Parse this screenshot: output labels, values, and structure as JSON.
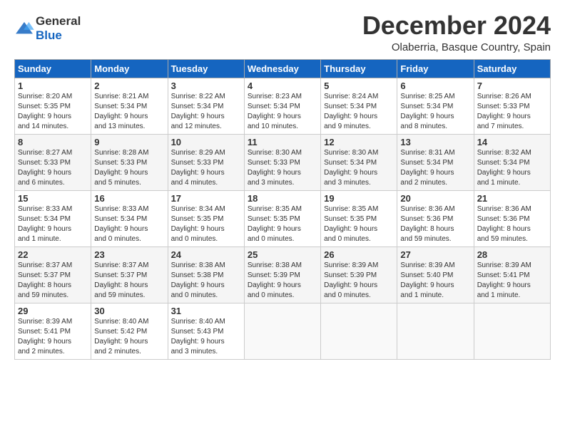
{
  "header": {
    "logo_line1": "General",
    "logo_line2": "Blue",
    "month_title": "December 2024",
    "location": "Olaberria, Basque Country, Spain"
  },
  "days_of_week": [
    "Sunday",
    "Monday",
    "Tuesday",
    "Wednesday",
    "Thursday",
    "Friday",
    "Saturday"
  ],
  "weeks": [
    [
      {
        "day": "1",
        "info": "Sunrise: 8:20 AM\nSunset: 5:35 PM\nDaylight: 9 hours\nand 14 minutes."
      },
      {
        "day": "2",
        "info": "Sunrise: 8:21 AM\nSunset: 5:34 PM\nDaylight: 9 hours\nand 13 minutes."
      },
      {
        "day": "3",
        "info": "Sunrise: 8:22 AM\nSunset: 5:34 PM\nDaylight: 9 hours\nand 12 minutes."
      },
      {
        "day": "4",
        "info": "Sunrise: 8:23 AM\nSunset: 5:34 PM\nDaylight: 9 hours\nand 10 minutes."
      },
      {
        "day": "5",
        "info": "Sunrise: 8:24 AM\nSunset: 5:34 PM\nDaylight: 9 hours\nand 9 minutes."
      },
      {
        "day": "6",
        "info": "Sunrise: 8:25 AM\nSunset: 5:34 PM\nDaylight: 9 hours\nand 8 minutes."
      },
      {
        "day": "7",
        "info": "Sunrise: 8:26 AM\nSunset: 5:33 PM\nDaylight: 9 hours\nand 7 minutes."
      }
    ],
    [
      {
        "day": "8",
        "info": "Sunrise: 8:27 AM\nSunset: 5:33 PM\nDaylight: 9 hours\nand 6 minutes."
      },
      {
        "day": "9",
        "info": "Sunrise: 8:28 AM\nSunset: 5:33 PM\nDaylight: 9 hours\nand 5 minutes."
      },
      {
        "day": "10",
        "info": "Sunrise: 8:29 AM\nSunset: 5:33 PM\nDaylight: 9 hours\nand 4 minutes."
      },
      {
        "day": "11",
        "info": "Sunrise: 8:30 AM\nSunset: 5:33 PM\nDaylight: 9 hours\nand 3 minutes."
      },
      {
        "day": "12",
        "info": "Sunrise: 8:30 AM\nSunset: 5:34 PM\nDaylight: 9 hours\nand 3 minutes."
      },
      {
        "day": "13",
        "info": "Sunrise: 8:31 AM\nSunset: 5:34 PM\nDaylight: 9 hours\nand 2 minutes."
      },
      {
        "day": "14",
        "info": "Sunrise: 8:32 AM\nSunset: 5:34 PM\nDaylight: 9 hours\nand 1 minute."
      }
    ],
    [
      {
        "day": "15",
        "info": "Sunrise: 8:33 AM\nSunset: 5:34 PM\nDaylight: 9 hours\nand 1 minute."
      },
      {
        "day": "16",
        "info": "Sunrise: 8:33 AM\nSunset: 5:34 PM\nDaylight: 9 hours\nand 0 minutes."
      },
      {
        "day": "17",
        "info": "Sunrise: 8:34 AM\nSunset: 5:35 PM\nDaylight: 9 hours\nand 0 minutes."
      },
      {
        "day": "18",
        "info": "Sunrise: 8:35 AM\nSunset: 5:35 PM\nDaylight: 9 hours\nand 0 minutes."
      },
      {
        "day": "19",
        "info": "Sunrise: 8:35 AM\nSunset: 5:35 PM\nDaylight: 9 hours\nand 0 minutes."
      },
      {
        "day": "20",
        "info": "Sunrise: 8:36 AM\nSunset: 5:36 PM\nDaylight: 8 hours\nand 59 minutes."
      },
      {
        "day": "21",
        "info": "Sunrise: 8:36 AM\nSunset: 5:36 PM\nDaylight: 8 hours\nand 59 minutes."
      }
    ],
    [
      {
        "day": "22",
        "info": "Sunrise: 8:37 AM\nSunset: 5:37 PM\nDaylight: 8 hours\nand 59 minutes."
      },
      {
        "day": "23",
        "info": "Sunrise: 8:37 AM\nSunset: 5:37 PM\nDaylight: 8 hours\nand 59 minutes."
      },
      {
        "day": "24",
        "info": "Sunrise: 8:38 AM\nSunset: 5:38 PM\nDaylight: 9 hours\nand 0 minutes."
      },
      {
        "day": "25",
        "info": "Sunrise: 8:38 AM\nSunset: 5:39 PM\nDaylight: 9 hours\nand 0 minutes."
      },
      {
        "day": "26",
        "info": "Sunrise: 8:39 AM\nSunset: 5:39 PM\nDaylight: 9 hours\nand 0 minutes."
      },
      {
        "day": "27",
        "info": "Sunrise: 8:39 AM\nSunset: 5:40 PM\nDaylight: 9 hours\nand 1 minute."
      },
      {
        "day": "28",
        "info": "Sunrise: 8:39 AM\nSunset: 5:41 PM\nDaylight: 9 hours\nand 1 minute."
      }
    ],
    [
      {
        "day": "29",
        "info": "Sunrise: 8:39 AM\nSunset: 5:41 PM\nDaylight: 9 hours\nand 2 minutes."
      },
      {
        "day": "30",
        "info": "Sunrise: 8:40 AM\nSunset: 5:42 PM\nDaylight: 9 hours\nand 2 minutes."
      },
      {
        "day": "31",
        "info": "Sunrise: 8:40 AM\nSunset: 5:43 PM\nDaylight: 9 hours\nand 3 minutes."
      },
      {
        "day": "",
        "info": ""
      },
      {
        "day": "",
        "info": ""
      },
      {
        "day": "",
        "info": ""
      },
      {
        "day": "",
        "info": ""
      }
    ]
  ]
}
